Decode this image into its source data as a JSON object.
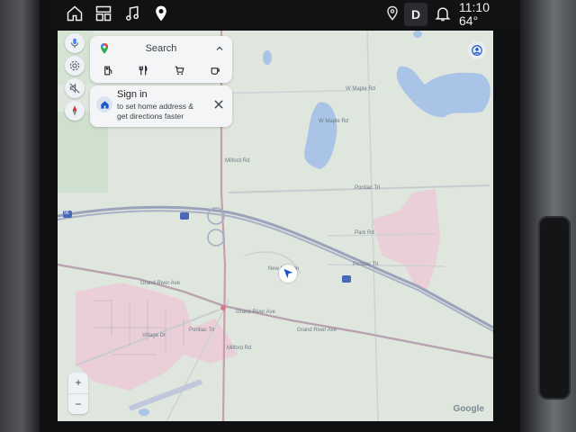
{
  "status_bar": {
    "icons": [
      "home-icon",
      "apps-grid-icon",
      "music-note-icon",
      "location-pin-icon"
    ],
    "location_status_icon": "location-outline-icon",
    "gear": "D",
    "notification_icon": "bell-icon",
    "time": "11:10",
    "temperature": "64°"
  },
  "side_controls": [
    "microphone-icon",
    "settings-icon",
    "mute-alerts-icon",
    "compass-icon"
  ],
  "search": {
    "placeholder": "Search",
    "categories": [
      "gas-station-icon",
      "restaurants-icon",
      "shopping-icon",
      "coffee-icon"
    ]
  },
  "signin": {
    "title": "Sign in",
    "subtitle_line1": "to set home address &",
    "subtitle_line2": "get directions faster"
  },
  "map": {
    "labels": {
      "w_maple_rd_top": "W Maple Rd",
      "w_maple_rd": "W Maple Rd",
      "pontiac_trail_top": "Pontiac Trl",
      "park_rd": "Park Rd",
      "pontiac_trail_right": "Pontiac Trl",
      "new_hudson": "New Hudson",
      "grand_river_ave_left": "Grand River Ave",
      "grand_river_ave_mid": "Grand River Ave",
      "grand_river_ave_right": "Grand River Ave",
      "pontiac_trail_left": "Pontiac Trl",
      "village_dr": "Village Dr",
      "milford_rd": "Milford Rd",
      "milford_rd_lower": "Milford Rd",
      "i96_shield": "96"
    },
    "attribution": "Google"
  },
  "zoom": {
    "in_label": "+",
    "out_label": "−"
  },
  "colors": {
    "map_bg": "#dfe6dd",
    "water": "#a9c4e6",
    "urban": "#eacfd8",
    "highway": "#9aa3bb",
    "nav_arrow": "#1a55c9"
  }
}
